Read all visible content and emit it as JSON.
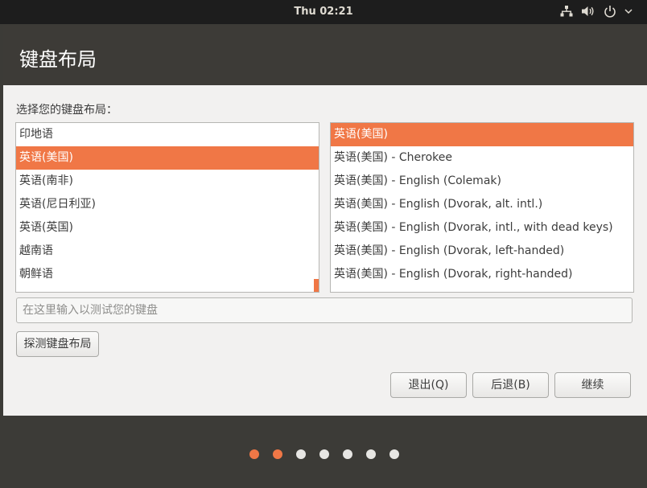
{
  "topbar": {
    "clock": "Thu 02:21",
    "icons": [
      "network-icon",
      "volume-icon",
      "power-icon",
      "chevron-down-icon"
    ]
  },
  "window": {
    "title": "键盘布局",
    "prompt": "选择您的键盘布局：",
    "layouts": [
      "印地语",
      "英语(美国)",
      "英语(南非)",
      "英语(尼日利亚)",
      "英语(英国)",
      "越南语",
      "朝鲜语"
    ],
    "selected_layout_index": 1,
    "variants": [
      "英语(美国)",
      "英语(美国) - Cherokee",
      "英语(美国) - English (Colemak)",
      "英语(美国) - English (Dvorak, alt. intl.)",
      "英语(美国) - English (Dvorak, intl., with dead keys)",
      "英语(美国) - English (Dvorak, left-handed)",
      "英语(美国) - English (Dvorak, right-handed)"
    ],
    "selected_variant_index": 0,
    "test_input": {
      "placeholder": "在这里输入以测试您的键盘",
      "value": ""
    },
    "detect_button": "探测键盘布局",
    "quit_button": "退出(Q)",
    "back_button": "后退(B)",
    "continue_button": "继续"
  },
  "progress": {
    "total_steps": 7,
    "completed_steps": 2
  },
  "colors": {
    "accent": "#f07746",
    "header": "#3c3b37",
    "content_bg": "#f2f1f0"
  }
}
